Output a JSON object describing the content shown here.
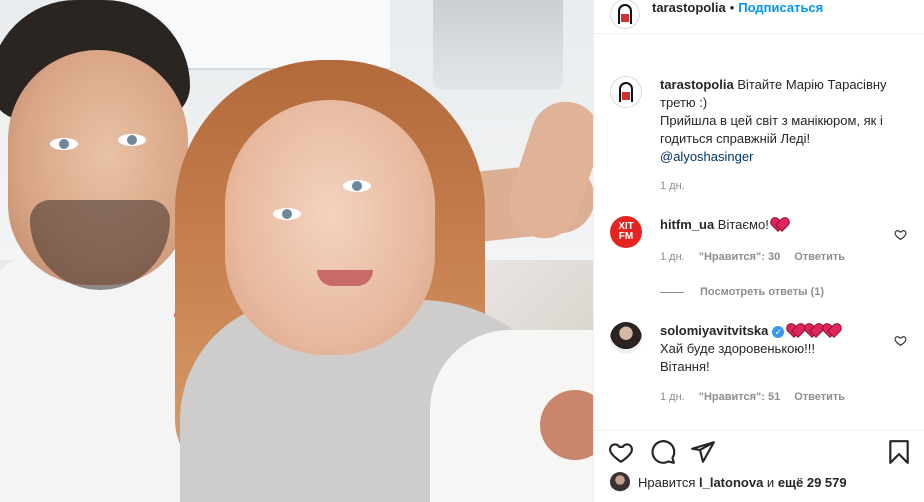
{
  "post": {
    "author": "tarastopolia",
    "follow_label": "Подписаться",
    "separator": "•"
  },
  "caption": {
    "username": "tarastopolia",
    "text_line1": "Вітайте Марію Тарасівну третю :)",
    "text_line2": "Прийшла в цей світ з манікюром, як і годиться справжній Леді!",
    "mention": "@alyoshasinger",
    "time": "1 дн."
  },
  "comments": [
    {
      "username": "hitfm_ua",
      "avatar_text": "ХІТ FM",
      "text": "Вітаємо!",
      "time": "1 дн.",
      "likes": "\"Нравится\": 30",
      "reply_label": "Ответить",
      "view_replies": "Посмотреть ответы (1)"
    },
    {
      "username": "solomiyavitvitska",
      "verified_mark": "✓",
      "text_line1": "Хай буде здоровенькою!!!",
      "text_line2": "Вітання!",
      "time": "1 дн.",
      "likes": "\"Нравится\": 51",
      "reply_label": "Ответить"
    }
  ],
  "likes_bar": {
    "prefix": "Нравится",
    "user": "l_latonova",
    "and": "и",
    "rest": "ещё 29 579"
  },
  "icons": [
    "heart-icon",
    "comment-icon",
    "share-icon",
    "bookmark-icon",
    "small-heart-icon",
    "verified-icon"
  ],
  "colors": {
    "link_blue": "#0095f6",
    "heart_red": "#e0245e",
    "muted": "#8e8e8e"
  }
}
